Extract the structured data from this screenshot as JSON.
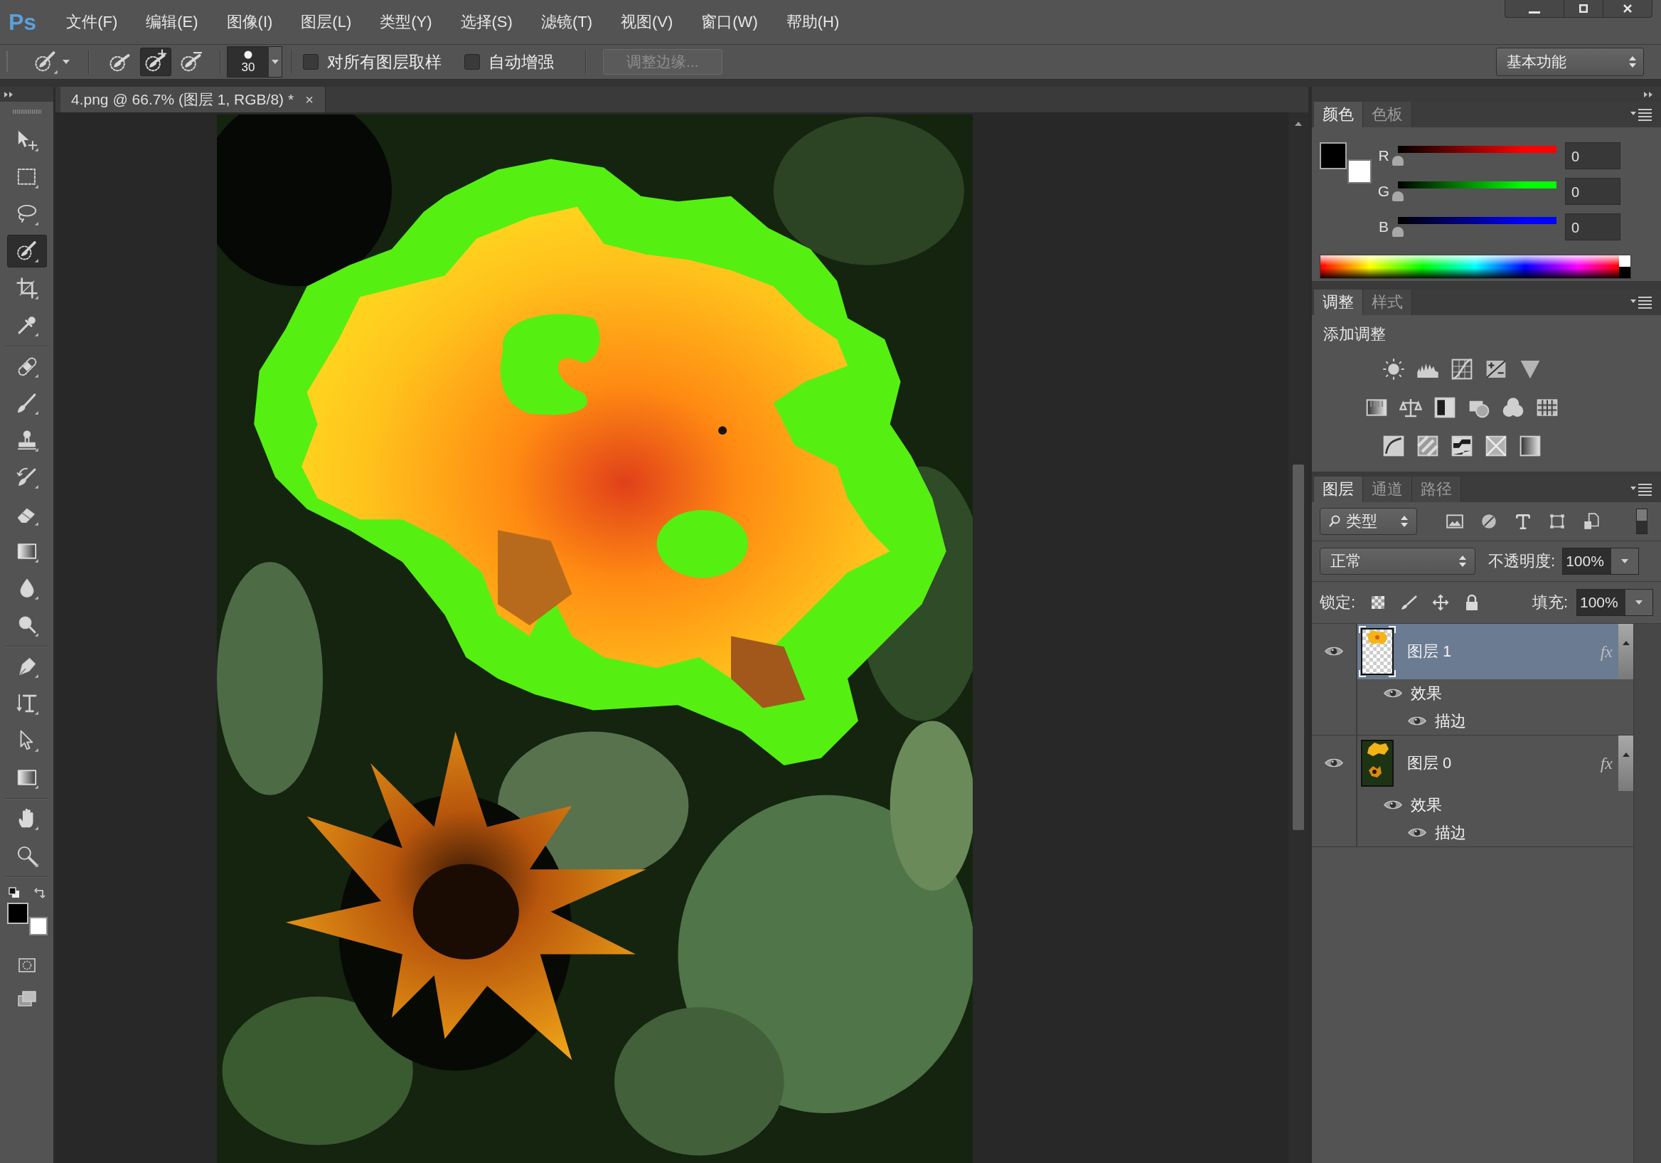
{
  "menu_bar": {
    "logo": "Ps",
    "items": [
      "文件(F)",
      "编辑(E)",
      "图像(I)",
      "图层(L)",
      "类型(Y)",
      "选择(S)",
      "滤镜(T)",
      "视图(V)",
      "窗口(W)",
      "帮助(H)"
    ]
  },
  "options_bar": {
    "modes": [
      {
        "kind": "new",
        "selected": false
      },
      {
        "kind": "add",
        "selected": true
      },
      {
        "kind": "subtract",
        "selected": false
      }
    ],
    "brush_size": "30",
    "options": [
      {
        "label": "对所有图层取样",
        "checked": false
      },
      {
        "label": "自动增强",
        "checked": false
      }
    ],
    "refine_edge": {
      "label": "调整边缘...",
      "disabled": true
    },
    "workspace": "基本功能"
  },
  "document_tab": {
    "title": "4.png @ 66.7% (图层 1, RGB/8) *",
    "close": "×"
  },
  "toolbar": {
    "groups": [
      [
        {
          "kind": "move",
          "selected": false
        },
        {
          "kind": "marquee",
          "selected": false
        },
        {
          "kind": "lasso",
          "selected": false
        },
        {
          "kind": "quickselect",
          "selected": true
        },
        {
          "kind": "crop",
          "selected": false
        },
        {
          "kind": "eyedropper",
          "selected": false
        }
      ],
      [
        {
          "kind": "healing",
          "selected": false
        },
        {
          "kind": "brush",
          "selected": false
        },
        {
          "kind": "stamp",
          "selected": false
        },
        {
          "kind": "historybrush",
          "selected": false
        },
        {
          "kind": "eraser",
          "selected": false
        },
        {
          "kind": "gradient",
          "selected": false
        },
        {
          "kind": "blur",
          "selected": false
        },
        {
          "kind": "dodge",
          "selected": false
        }
      ],
      [
        {
          "kind": "pen",
          "selected": false
        },
        {
          "kind": "type",
          "selected": false
        },
        {
          "kind": "pathselect",
          "selected": false
        },
        {
          "kind": "rectangle",
          "selected": false
        }
      ],
      [
        {
          "kind": "hand",
          "selected": false
        },
        {
          "kind": "zoom",
          "selected": false
        }
      ]
    ],
    "swatches": [
      {
        "kind": "foreground",
        "color": "#000000"
      },
      {
        "kind": "background",
        "color": "#ffffff"
      }
    ]
  },
  "color_panel": {
    "tabs": [
      {
        "label": "颜色",
        "selected": true
      },
      {
        "label": "色板",
        "selected": false
      }
    ],
    "swatches": [
      {
        "kind": "foreground",
        "color": "#000000"
      },
      {
        "kind": "background",
        "color": "#ffffff"
      }
    ],
    "channels": [
      {
        "label": "R",
        "color": "#ff0000",
        "level": 0,
        "value": "0"
      },
      {
        "label": "G",
        "color": "#00ff00",
        "level": 0,
        "value": "0"
      },
      {
        "label": "B",
        "color": "#0000ff",
        "level": 0,
        "value": "0"
      }
    ]
  },
  "adjustments_panel": {
    "tabs": [
      {
        "label": "调整",
        "selected": true
      },
      {
        "label": "样式",
        "selected": false
      }
    ],
    "heading": "添加调整"
  },
  "layers_panel": {
    "tabs": [
      {
        "label": "图层",
        "selected": true
      },
      {
        "label": "通道",
        "selected": false
      },
      {
        "label": "路径",
        "selected": false
      }
    ],
    "filter": "类型",
    "filter_enabled": false,
    "blend_mode": "正常",
    "opacity_label": "不透明度:",
    "opacity": "100%",
    "lock_label": "锁定:",
    "fill_label": "填充:",
    "fill": "100%",
    "layers": [
      {
        "name": "图层 1",
        "kind": "cutout",
        "selected": true,
        "visible": true,
        "badge": "fx",
        "effects_label": "效果",
        "effects_visible": true,
        "effects": [
          {
            "name": "描边",
            "visible": true
          }
        ]
      },
      {
        "name": "图层 0",
        "kind": "photo",
        "selected": false,
        "visible": true,
        "badge": "fx",
        "effects_label": "效果",
        "effects_visible": true,
        "effects": [
          {
            "name": "描边",
            "visible": true
          }
        ]
      }
    ]
  }
}
